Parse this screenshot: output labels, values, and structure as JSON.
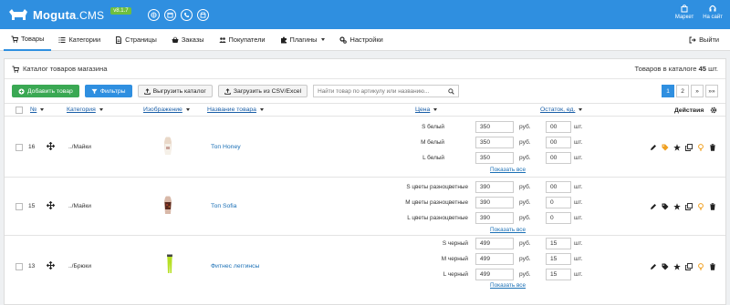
{
  "app": {
    "logo_name": "Moguta",
    "logo_suffix": ".CMS",
    "version": "v8.1.7"
  },
  "topbar": {
    "quick_icons": [
      "globe-icon",
      "calendar-icon",
      "phone-icon",
      "shop-icon"
    ],
    "right": [
      {
        "label": "Маркет",
        "icon": "shopping-bag-icon"
      },
      {
        "label": "На сайт",
        "icon": "headset-icon"
      }
    ]
  },
  "nav": {
    "items": [
      {
        "label": "Товары",
        "icon": "cart-icon",
        "active": true
      },
      {
        "label": "Категории",
        "icon": "list-icon"
      },
      {
        "label": "Страницы",
        "icon": "file-icon"
      },
      {
        "label": "Заказы",
        "icon": "basket-icon"
      },
      {
        "label": "Покупатели",
        "icon": "users-icon"
      },
      {
        "label": "Плагины",
        "icon": "puzzle-icon",
        "dropdown": true
      },
      {
        "label": "Настройки",
        "icon": "gears-icon"
      }
    ],
    "logout": "Выйти"
  },
  "panel": {
    "title": "Каталог товаров магазина",
    "count_prefix": "Товаров в каталоге",
    "count_value": "45",
    "count_suffix": "шт."
  },
  "toolbar": {
    "add": "Добавить товар",
    "filters": "Фильтры",
    "export": "Выгрузить каталог",
    "import": "Загрузить из CSV/Excel",
    "search_placeholder": "Найти товар по артикулу или названию...",
    "pages": [
      "1",
      "2",
      "»",
      "»»"
    ]
  },
  "table": {
    "headers": {
      "num": "№",
      "category": "Категория",
      "image": "Изображение",
      "name": "Название товара",
      "price": "Цена",
      "stock": "Остаток, ед.",
      "actions": "Действия"
    },
    "currency": "руб.",
    "unit": "шт.",
    "show_all": "Показать все",
    "rows": [
      {
        "num": "16",
        "category": "../Майки",
        "name": "Топ Honey",
        "variants": [
          {
            "name": "S белый",
            "price": "350",
            "stock": "00"
          },
          {
            "name": "M белый",
            "price": "350",
            "stock": "00"
          },
          {
            "name": "L белый",
            "price": "350",
            "stock": "00"
          }
        ]
      },
      {
        "num": "15",
        "category": "../Майки",
        "name": "Топ Sofia",
        "variants": [
          {
            "name": "S цветы разноцветные",
            "price": "390",
            "stock": "00"
          },
          {
            "name": "M цветы разноцветные",
            "price": "390",
            "stock": "0"
          },
          {
            "name": "L цветы разноцветные",
            "price": "390",
            "stock": "0"
          }
        ]
      },
      {
        "num": "13",
        "category": "../Брюки",
        "name": "Фитнес леггинсы",
        "variants": [
          {
            "name": "S черный",
            "price": "499",
            "stock": "15"
          },
          {
            "name": "M черный",
            "price": "499",
            "stock": "15"
          },
          {
            "name": "L черный",
            "price": "499",
            "stock": "15"
          }
        ]
      }
    ]
  },
  "colors": {
    "accent": "#2f8fe0",
    "green": "#3aa853",
    "link": "#1a6fb5"
  }
}
